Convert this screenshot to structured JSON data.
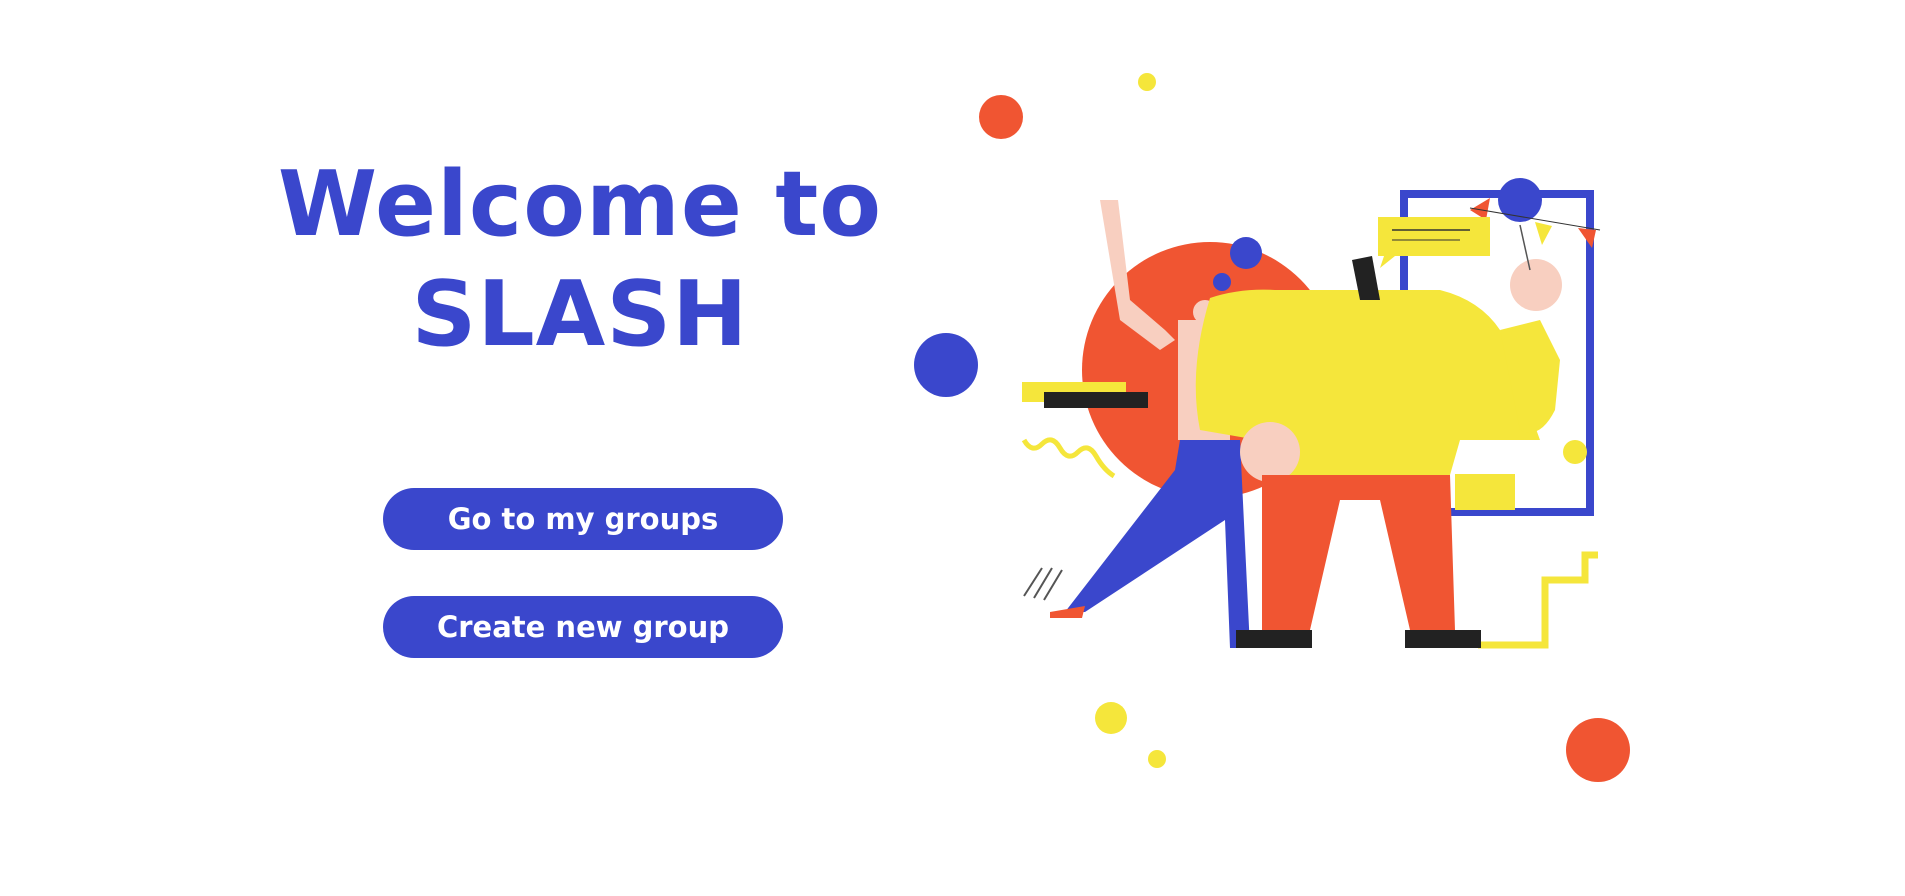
{
  "hero": {
    "title_line1": "Welcome to",
    "title_line2": "SLASH"
  },
  "actions": {
    "go_to_groups_label": "Go to my groups",
    "create_group_label": "Create new group"
  },
  "illustration": {
    "icon": "people-celebrating-illustration"
  },
  "colors": {
    "primary": "#3a47cc",
    "accent_orange": "#f05532",
    "accent_yellow": "#f5e63b",
    "background": "#ffffff"
  }
}
